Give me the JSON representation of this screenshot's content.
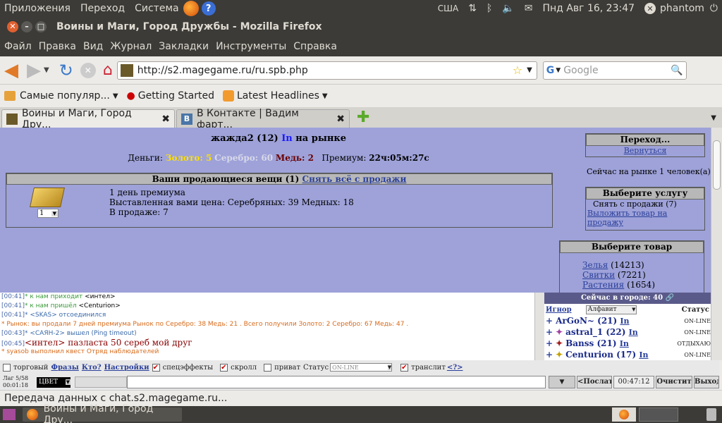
{
  "panel": {
    "apps": "Приложения",
    "go": "Переход",
    "system": "Система",
    "kbd": "США",
    "clock": "Пнд Авг 16, 23:47",
    "user": "phantom"
  },
  "window": {
    "title": "Воины и Маги, Город Дружбы - Mozilla Firefox"
  },
  "menu": [
    "Файл",
    "Правка",
    "Вид",
    "Журнал",
    "Закладки",
    "Инструменты",
    "Справка"
  ],
  "nav": {
    "url": "http://s2.magegame.ru/ru.spb.php",
    "search_placeholder": "Google"
  },
  "bookmarks": {
    "b1": "Самые популяр...",
    "b2": "Getting Started",
    "b3": "Latest Headlines"
  },
  "tabs": {
    "t1": "Воины и Маги, Город Дру...",
    "t2": "В Контакте | Вадим фарт..."
  },
  "page": {
    "heading_name": "жажда2 (12)",
    "heading_in": "In",
    "heading_place": "на рынке",
    "money_label": "Деньги:",
    "gold": "Золото: 5",
    "silver": "Серебро: 60",
    "copper": "Медь: 2",
    "premium_label": "Премиум:",
    "premium_time": "22ч:05м:27с",
    "sale_title": "Ваши продающиеся вещи (1)",
    "sale_link": "Снять всё с продажи",
    "item_line1": "1 день премиума",
    "item_line2": "Выставленная вами цена: Серебряных: 39 Медных: 18",
    "item_line3": "В продаже: 7",
    "qty": "1",
    "nav_title": "Переход...",
    "nav_back": "Вернуться",
    "market_count": "Сейчас на рынке 1 человек(а)",
    "service_title": "Выберите услугу",
    "service1": "Снять с продажи (7)",
    "service2": "Выложить товар на продажу",
    "goods_title": "Выберите товар",
    "goods": [
      {
        "name": "Зелья",
        "count": "(14213)"
      },
      {
        "name": "Свитки",
        "count": "(7221)"
      },
      {
        "name": "Растения",
        "count": "(1654)"
      }
    ]
  },
  "chat": [
    {
      "t": "[00:41]",
      "m": "* к нам приходит ",
      "n": "<интел>",
      "c": "#3a9a3a"
    },
    {
      "t": "[00:41]",
      "m": "* к нам пришёл ",
      "n": "<Centurion>",
      "c": "#3a9a3a"
    },
    {
      "t": "[00:41]",
      "m": "* ",
      "n": "<SKAS> отсоединился",
      "c": "#3a6aaa"
    },
    {
      "t": "",
      "m": "* Рынок: вы продали 7 дней премиума Рынок по Серебро: 38 Медь: 21 . Всего получили Золото: 2 Серебро: 67 Медь: 47 .",
      "n": "",
      "c": "#d86a1a"
    },
    {
      "t": "[00:43]",
      "m": "* ",
      "n": "<САЯН-2> вышел (Ping timeout)",
      "c": "#3a6aaa"
    },
    {
      "t": "[00:45]",
      "m": "",
      "n": "<интел> пaзлаcта 50 сереб мой друг",
      "c": "#8a0000"
    },
    {
      "t": "",
      "m": "* syasob выполнил квест Отряд наблюдателей",
      "n": "",
      "c": "#d86a1a"
    }
  ],
  "users": {
    "header": "Сейчас в городе: 40",
    "ignore": "Игнор",
    "sort": "Алфавит",
    "status": "Статус",
    "list": [
      {
        "name": "ArGoN~ (21)",
        "in": "In",
        "st": "ON-LINE"
      },
      {
        "name": "astral_1 (22)",
        "in": "In",
        "st": "ON-LINE"
      },
      {
        "name": "Banss (21)",
        "in": "In",
        "st": "ОТДЫХАЮ"
      },
      {
        "name": "Centurion (17)",
        "in": "In",
        "st": "ON-LINE"
      }
    ]
  },
  "chatbar": {
    "trade": "торговый",
    "phrases": "Фразы",
    "who": "Кто?",
    "settings": "Настройки",
    "effects": "спецэффекты",
    "scroll": "скролл",
    "private": "приват",
    "status_label": "Статус",
    "status_val": "ON-LINE",
    "translit": "транслит",
    "help": "<?>"
  },
  "inputbar": {
    "lag": "Лаг 5/58",
    "time": "00:01:18",
    "color": "ЦВЕТ",
    "send": "<Послат",
    "clock": "00:47:12",
    "clear": "Очистит",
    "exit": "Выход"
  },
  "status": "Передача данных с chat.s2.magegame.ru...",
  "taskbar": {
    "task": "Воины и Маги, Город Дру..."
  }
}
